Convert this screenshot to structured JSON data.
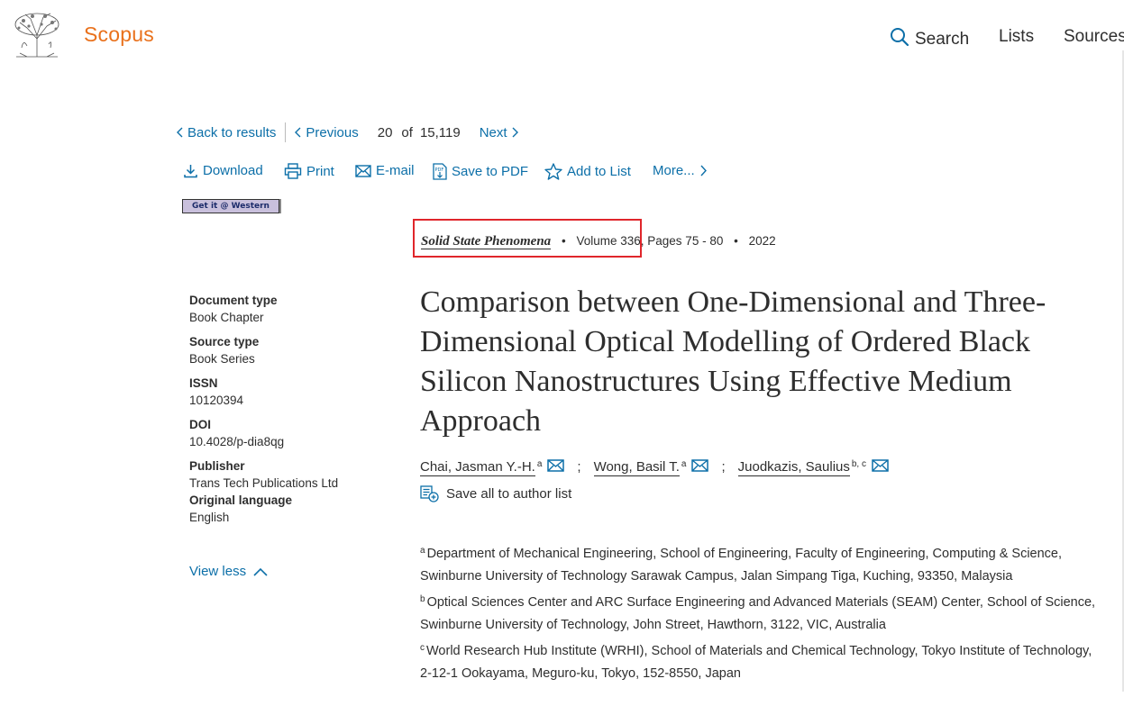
{
  "header": {
    "brand": "Scopus",
    "nav": {
      "search": "Search",
      "lists": "Lists",
      "sources": "Sources"
    }
  },
  "result_nav": {
    "back": "Back to results",
    "previous": "Previous",
    "position": "20",
    "of": "of",
    "total": "15,119",
    "next": "Next"
  },
  "actions": {
    "download": "Download",
    "print": "Print",
    "email": "E-mail",
    "save_pdf": "Save to PDF",
    "add_list": "Add to List",
    "more": "More..."
  },
  "getit": "Get it @ Western",
  "source": {
    "journal": "Solid State Phenomena",
    "volume": "Volume 336,",
    "pages": "Pages 75 - 80",
    "year": "2022"
  },
  "meta": {
    "doc_type_label": "Document type",
    "doc_type": "Book Chapter",
    "source_type_label": "Source type",
    "source_type": "Book Series",
    "issn_label": "ISSN",
    "issn": "10120394",
    "doi_label": "DOI",
    "doi": "10.4028/p-dia8qg",
    "publisher_label": "Publisher",
    "publisher": "Trans Tech Publications Ltd",
    "language_label": "Original language",
    "language": "English",
    "view_less": "View less"
  },
  "title": "Comparison between One-Dimensional and Three-Dimensional Optical Modelling of Ordered Black Silicon Nanostructures Using Effective Medium Approach",
  "authors": [
    {
      "name": "Chai, Jasman Y.-H.",
      "sup": "a"
    },
    {
      "name": "Wong, Basil T.",
      "sup": "a"
    },
    {
      "name": "Juodkazis, Saulius",
      "sup": "b, c"
    }
  ],
  "author_sep": ";",
  "save_all": "Save all to author list",
  "affiliations": [
    {
      "key": "a",
      "text": "Department of Mechanical Engineering, School of Engineering, Faculty of Engineering, Computing & Science, Swinburne University of Technology Sarawak Campus, Jalan Simpang Tiga, Kuching, 93350, Malaysia"
    },
    {
      "key": "b",
      "text": "Optical Sciences Center and ARC Surface Engineering and Advanced Materials (SEAM) Center, School of Science, Swinburne University of Technology, John Street, Hawthorn, 3122, VIC, Australia"
    },
    {
      "key": "c",
      "text": "World Research Hub Institute (WRHI), School of Materials and Chemical Technology, Tokyo Institute of Technology, 2-12-1 Ookayama, Meguro-ku, Tokyo, 152-8550, Japan"
    }
  ],
  "colors": {
    "brand": "#e9711c",
    "link": "#0c6fa8",
    "highlight": "#e0262b"
  }
}
